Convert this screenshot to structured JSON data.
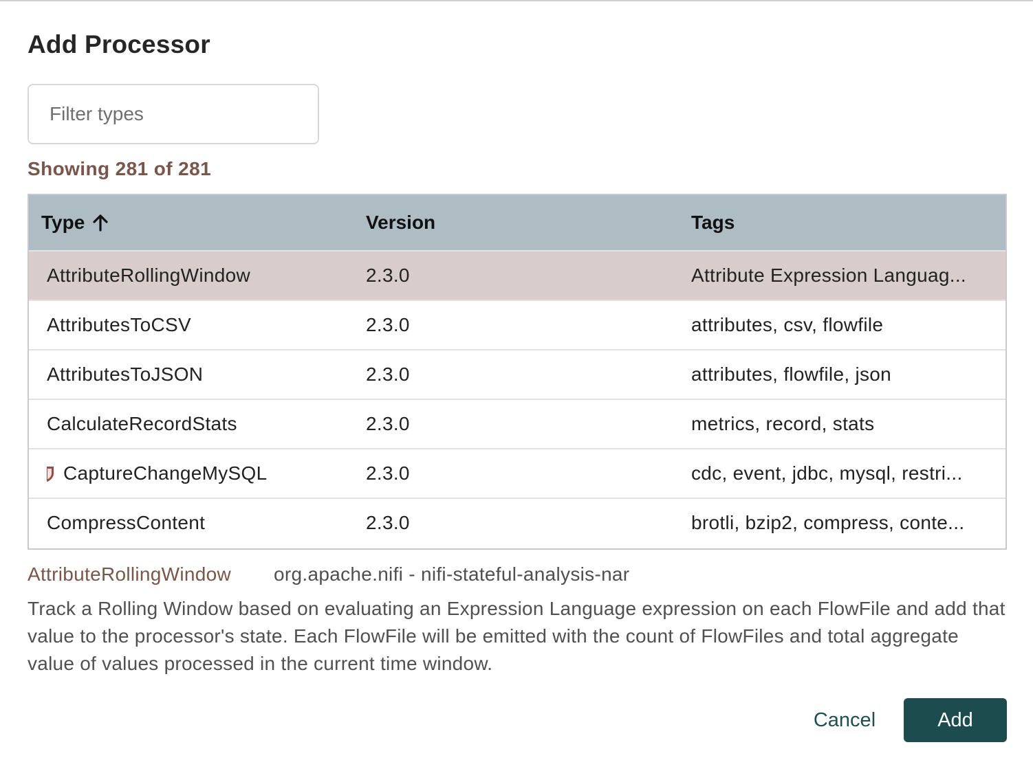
{
  "dialog": {
    "title": "Add Processor"
  },
  "filter": {
    "placeholder": "Filter types",
    "value": ""
  },
  "summary": {
    "showing_text": "Showing 281 of 281"
  },
  "table": {
    "columns": {
      "type": "Type",
      "version": "Version",
      "tags": "Tags"
    },
    "sort": {
      "column": "Type",
      "direction": "ascending",
      "icon": "arrow-up-icon"
    },
    "rows": [
      {
        "type": "AttributeRollingWindow",
        "version": "2.3.0",
        "tags": "Attribute Expression Languag...",
        "selected": true,
        "restricted": false
      },
      {
        "type": "AttributesToCSV",
        "version": "2.3.0",
        "tags": "attributes, csv, flowfile",
        "selected": false,
        "restricted": false
      },
      {
        "type": "AttributesToJSON",
        "version": "2.3.0",
        "tags": "attributes, flowfile, json",
        "selected": false,
        "restricted": false
      },
      {
        "type": "CalculateRecordStats",
        "version": "2.3.0",
        "tags": "metrics, record, stats",
        "selected": false,
        "restricted": false
      },
      {
        "type": "CaptureChangeMySQL",
        "version": "2.3.0",
        "tags": "cdc, event, jdbc, mysql, restri...",
        "selected": false,
        "restricted": true
      },
      {
        "type": "CompressContent",
        "version": "2.3.0",
        "tags": "brotli, bzip2, compress, conte...",
        "selected": false,
        "restricted": false
      }
    ]
  },
  "details": {
    "name": "AttributeRollingWindow",
    "bundle": "org.apache.nifi - nifi-stateful-analysis-nar",
    "description": "Track a Rolling Window based on evaluating an Expression Language expression on each FlowFile and add that value to the processor's state. Each FlowFile will be emitted with the count of FlowFiles and total aggregate value of values processed in the current time window."
  },
  "actions": {
    "cancel_label": "Cancel",
    "add_label": "Add"
  },
  "colors": {
    "header_bg": "#aebcc3",
    "selected_row_bg": "#d8cdcb",
    "accent_brown": "#7a5648",
    "primary_button": "#1d4c4e",
    "restricted_icon": "#9b4a40"
  }
}
